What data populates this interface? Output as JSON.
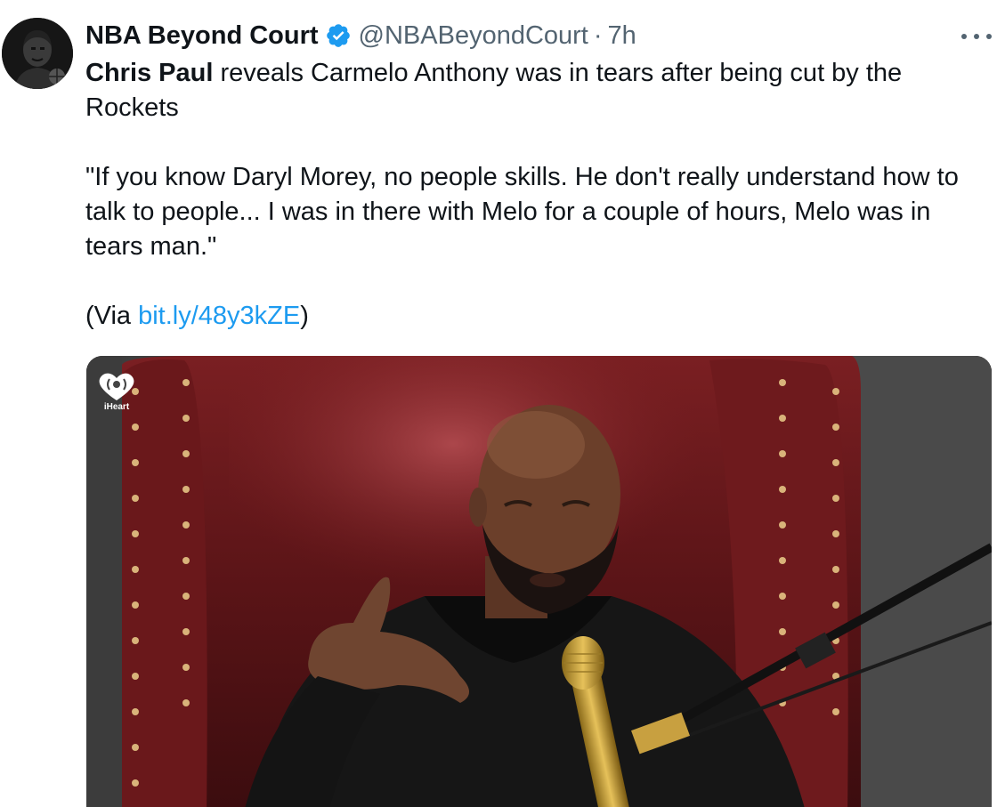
{
  "tweet": {
    "author": {
      "display_name": "NBA Beyond Court",
      "handle": "@NBABeyondCourt",
      "separator": "·",
      "time": "7h",
      "verified": true,
      "verified_color": "#1d9bf0"
    },
    "more_icon": "more-horizontal-icon",
    "text": {
      "line1_bold": "Chris Paul",
      "line1_rest": " reveals Carmelo Anthony was in tears after being cut by the Rockets",
      "quote": "\"If you know Daryl Morey, no people skills. He don't really understand how to talk to people... I was in there with Melo for a couple of hours, Melo was in tears man.\"",
      "via_prefix": "(Via ",
      "via_link": "bit.ly/48y3kZE",
      "via_suffix": ")"
    },
    "media": {
      "watermark": "iHeart",
      "watermark_icon": "iheart-radio-icon"
    }
  },
  "colors": {
    "text_primary": "#0f1419",
    "text_secondary": "#536471",
    "link": "#1d9bf0"
  }
}
